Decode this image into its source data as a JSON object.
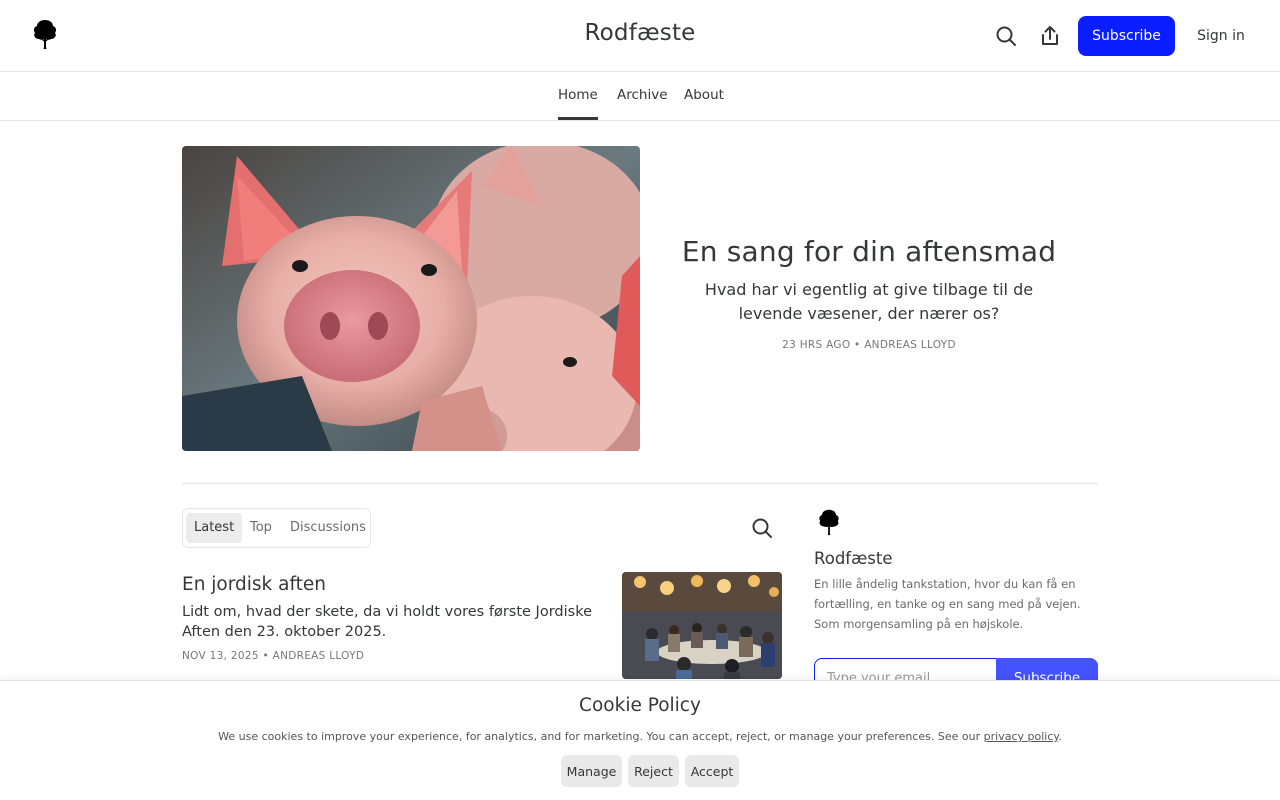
{
  "header": {
    "site_title": "Rodfæste",
    "logo_icon": "tree-icon",
    "search_icon": "search-icon",
    "share_icon": "share-icon",
    "subscribe_label": "Subscribe",
    "signin_label": "Sign in",
    "accent_color": "#0a1eff"
  },
  "nav": {
    "items": [
      {
        "label": "Home",
        "active": true
      },
      {
        "label": "Archive",
        "active": false
      },
      {
        "label": "About",
        "active": false
      }
    ]
  },
  "hero": {
    "title": "En sang for din aftensmad",
    "subtitle": "Hvad har vi egentlig at give tilbage til de levende væsener, der nærer os?",
    "date": "23 HRS AGO",
    "author": "ANDREAS LLOYD",
    "image_subject": "piglets"
  },
  "feed": {
    "tabs": [
      {
        "label": "Latest",
        "active": true
      },
      {
        "label": "Top",
        "active": false
      },
      {
        "label": "Discussions",
        "active": false
      }
    ],
    "search_icon": "search-icon",
    "posts": [
      {
        "title": "En jordisk aften",
        "subtitle": "Lidt om, hvad der skete, da vi holdt vores første Jordiske Aften den 23. oktober 2025.",
        "date": "NOV 13, 2025",
        "author": "ANDREAS LLOYD",
        "image_subject": "dinner-gathering"
      }
    ]
  },
  "sidebar": {
    "name": "Rodfæste",
    "description": "En lille åndelig tankstation, hvor du kan få en fortælling, en tanke og en sang med på vejen. Som morgensamling på en højskole.",
    "email_placeholder": "Type your email...",
    "subscribe_label": "Subscribe"
  },
  "cookie": {
    "title": "Cookie Policy",
    "text": "We use cookies to improve your experience, for analytics, and for marketing. You can accept, reject, or manage your preferences. See our ",
    "link": "privacy policy",
    "text_end": ".",
    "buttons": {
      "manage": "Manage",
      "reject": "Reject",
      "accept": "Accept"
    }
  },
  "meta_separator": " • "
}
